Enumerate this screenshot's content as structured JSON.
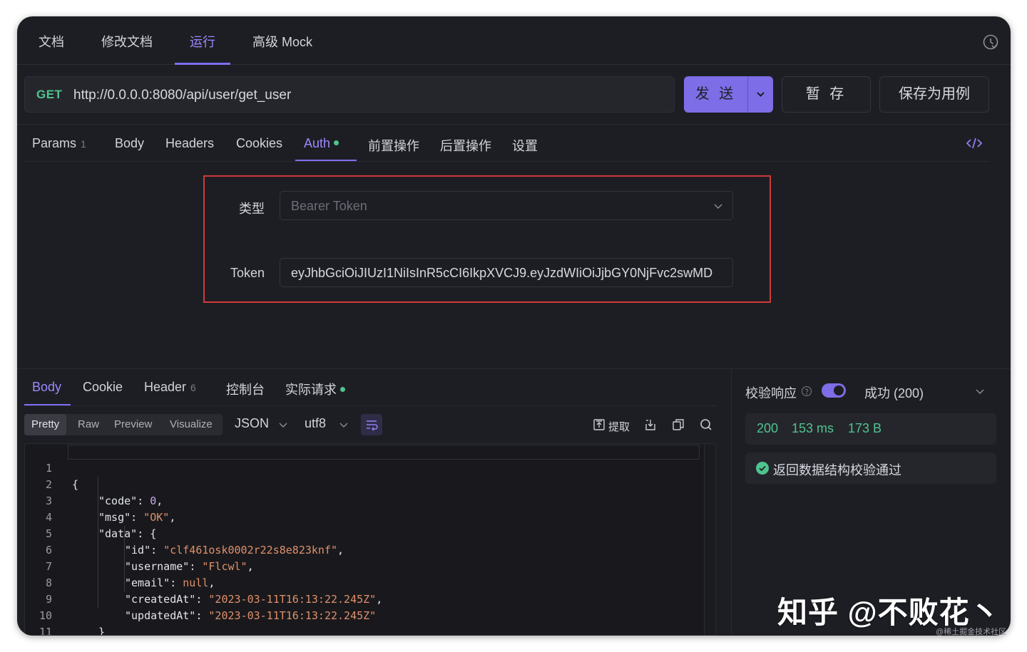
{
  "top_tabs": [
    {
      "label": "文档"
    },
    {
      "label": "修改文档"
    },
    {
      "label": "运行"
    },
    {
      "label": "高级 Mock"
    }
  ],
  "request": {
    "method": "GET",
    "url": "http://0.0.0.0:8080/api/user/get_user",
    "send_label": "发 送",
    "stash_label": "暂 存",
    "save_example_label": "保存为用例"
  },
  "request_tabs": [
    {
      "label": "Params",
      "count": "1"
    },
    {
      "label": "Body"
    },
    {
      "label": "Headers"
    },
    {
      "label": "Cookies"
    },
    {
      "label": "Auth"
    },
    {
      "label": "前置操作"
    },
    {
      "label": "后置操作"
    },
    {
      "label": "设置"
    }
  ],
  "auth": {
    "type_label": "类型",
    "type_placeholder": "Bearer Token",
    "token_label": "Token",
    "token_value": "eyJhbGciOiJIUzI1NiIsInR5cCI6IkpXVCJ9.eyJzdWIiOiJjbGY0NjFvc2swMD"
  },
  "response_tabs": [
    {
      "label": "Body"
    },
    {
      "label": "Cookie"
    },
    {
      "label": "Header",
      "count": "6"
    },
    {
      "label": "控制台"
    },
    {
      "label": "实际请求"
    }
  ],
  "view_modes": [
    "Pretty",
    "Raw",
    "Preview",
    "Visualize"
  ],
  "format": "JSON",
  "encoding": "utf8",
  "extract_label": "提取",
  "code_lines": [
    {
      "n": "1",
      "text": "{"
    },
    {
      "n": "2",
      "text": "\"code\": 0,"
    },
    {
      "n": "3",
      "text": "\"msg\": \"OK\","
    },
    {
      "n": "4",
      "text": "\"data\": {"
    },
    {
      "n": "5",
      "text": "\"id\": \"clf461osk0002r22s8e823knf\","
    },
    {
      "n": "6",
      "text": "\"username\": \"Flcwl\","
    },
    {
      "n": "7",
      "text": "\"email\": null,"
    },
    {
      "n": "8",
      "text": "\"createdAt\": \"2023-03-11T16:13:22.245Z\","
    },
    {
      "n": "9",
      "text": "\"updatedAt\": \"2023-03-11T16:13:22.245Z\""
    },
    {
      "n": "10",
      "text": "}"
    },
    {
      "n": "11",
      "text": "}"
    }
  ],
  "validation": {
    "label": "校验响应",
    "enabled": true,
    "status_select": "成功 (200)",
    "status_code": "200",
    "time": "153 ms",
    "size": "173 B",
    "result_text": "返回数据结构校验通过"
  },
  "watermarks": {
    "zhihu": "知乎 @不败花丶",
    "juejin": "@稀土掘金技术社区"
  },
  "colors": {
    "accent": "#7d6de6",
    "success": "#4fc38e",
    "highlight_border": "#d03a3a",
    "background": "#1d1e23"
  }
}
